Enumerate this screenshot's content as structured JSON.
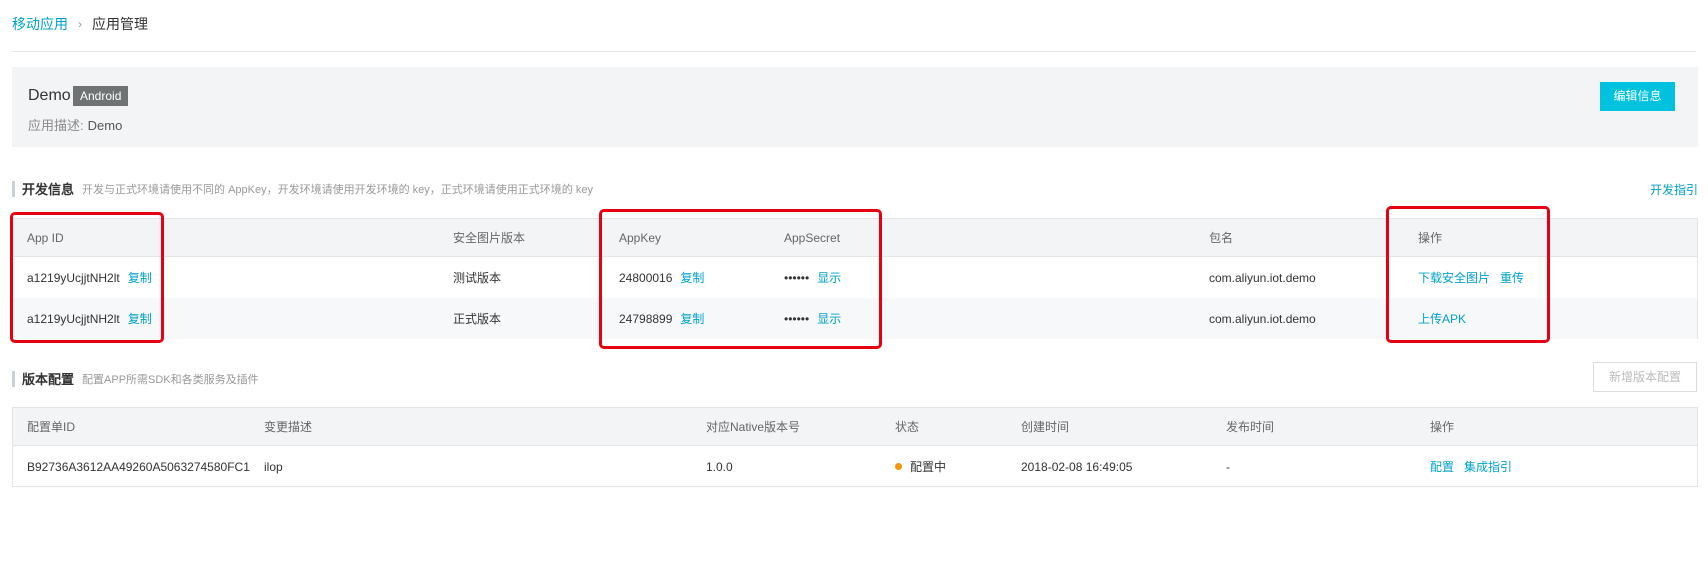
{
  "breadcrumb": {
    "parent": "移动应用",
    "current": "应用管理"
  },
  "app": {
    "name": "Demo",
    "platform": "Android",
    "desc_label": "应用描述:",
    "desc_value": "Demo",
    "edit_button": "编辑信息"
  },
  "dev_section": {
    "title": "开发信息",
    "hint": "开发与正式环境请使用不同的 AppKey，开发环境请使用开发环境的 key，正式环境请使用正式环境的 key",
    "guide_link": "开发指引",
    "columns": [
      "App ID",
      "安全图片版本",
      "AppKey",
      "AppSecret",
      "包名",
      "操作"
    ],
    "rows": [
      {
        "app_id": "a1219yUcjjtNH2lt",
        "copy_id": "复制",
        "image_version": "测试版本",
        "app_key": "24800016",
        "copy_key": "复制",
        "secret": "••••••",
        "show": "显示",
        "package": "com.aliyun.iot.demo",
        "actions": [
          "下载安全图片",
          "重传"
        ]
      },
      {
        "app_id": "a1219yUcjjtNH2lt",
        "copy_id": "复制",
        "image_version": "正式版本",
        "app_key": "24798899",
        "copy_key": "复制",
        "secret": "••••••",
        "show": "显示",
        "package": "com.aliyun.iot.demo",
        "actions": [
          "上传APK"
        ]
      }
    ]
  },
  "version_section": {
    "title": "版本配置",
    "hint": "配置APP所需SDK和各类服务及插件",
    "add_button": "新增版本配置",
    "columns": [
      "配置单ID",
      "变更描述",
      "对应Native版本号",
      "状态",
      "创建时间",
      "发布时间",
      "操作"
    ],
    "rows": [
      {
        "id": "B92736A3612AA49260A5063274580FC1",
        "desc": "ilop",
        "native_version": "1.0.0",
        "status": "配置中",
        "status_color": "#f89406",
        "created": "2018-02-08 16:49:05",
        "published": "-",
        "actions": [
          "配置",
          "集成指引"
        ]
      }
    ]
  },
  "colors": {
    "accent": "#00c1de",
    "link": "#00a2ca",
    "highlight": "#e60012",
    "badge": "#6f7374"
  }
}
